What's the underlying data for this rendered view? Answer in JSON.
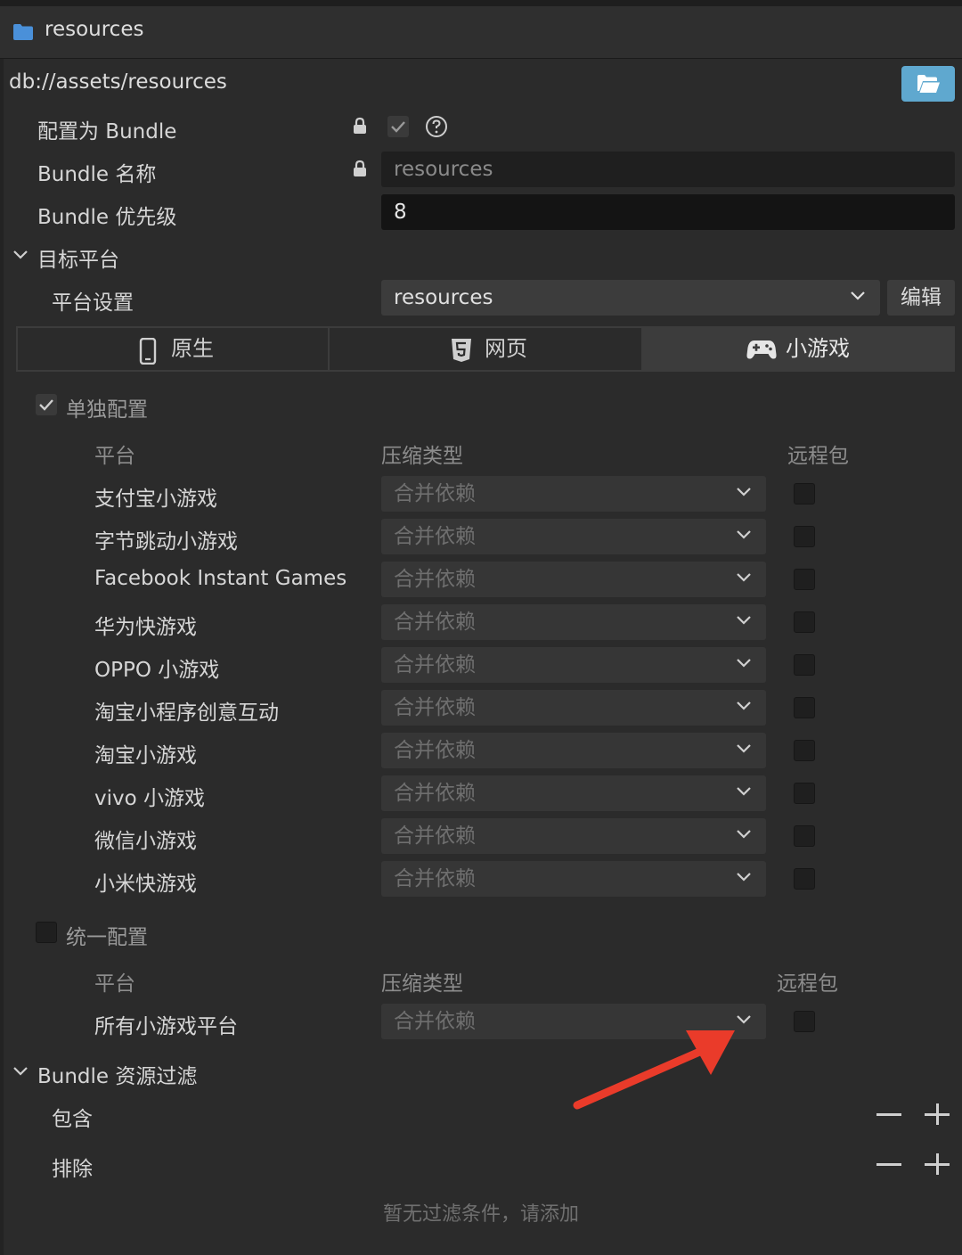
{
  "header": {
    "title": "resources",
    "folder_icon": "folder-icon"
  },
  "path": "db://assets/resources",
  "fields": {
    "bundle_config_label": "配置为 Bundle",
    "bundle_name_label": "Bundle 名称",
    "bundle_name_value": "resources",
    "bundle_priority_label": "Bundle 优先级",
    "bundle_priority_value": "8"
  },
  "target": {
    "section_label": "目标平台",
    "platform_settings_label": "平台设置",
    "platform_settings_value": "resources",
    "edit_label": "编辑"
  },
  "tabs": [
    {
      "label": "原生",
      "icon": "mobile-phone-icon"
    },
    {
      "label": "网页",
      "icon": "html5-icon"
    },
    {
      "label": "小游戏",
      "icon": "gamepad-icon",
      "selected": true
    }
  ],
  "separate": {
    "label": "单独配置",
    "checked": true,
    "col_platform": "平台",
    "col_compression": "压缩类型",
    "col_remote": "远程包",
    "rows": [
      {
        "platform": "支付宝小游戏",
        "compression": "合并依赖"
      },
      {
        "platform": "字节跳动小游戏",
        "compression": "合并依赖"
      },
      {
        "platform": "Facebook Instant Games",
        "compression": "合并依赖"
      },
      {
        "platform": "华为快游戏",
        "compression": "合并依赖"
      },
      {
        "platform": "OPPO 小游戏",
        "compression": "合并依赖"
      },
      {
        "platform": "淘宝小程序创意互动",
        "compression": "合并依赖"
      },
      {
        "platform": "淘宝小游戏",
        "compression": "合并依赖"
      },
      {
        "platform": "vivo 小游戏",
        "compression": "合并依赖"
      },
      {
        "platform": "微信小游戏",
        "compression": "合并依赖"
      },
      {
        "platform": "小米快游戏",
        "compression": "合并依赖"
      }
    ]
  },
  "unified": {
    "label": "统一配置",
    "checked": false,
    "col_platform": "平台",
    "col_compression": "压缩类型",
    "col_remote": "远程包",
    "row_platform": "所有小游戏平台",
    "row_compression": "合并依赖"
  },
  "filter": {
    "section_label": "Bundle 资源过滤",
    "include_label": "包含",
    "exclude_label": "排除",
    "empty_hint": "暂无过滤条件，请添加"
  },
  "colors": {
    "accent": "#5fa8cf",
    "arrow": "#ea3b2a",
    "background": "#2b2b2b"
  }
}
